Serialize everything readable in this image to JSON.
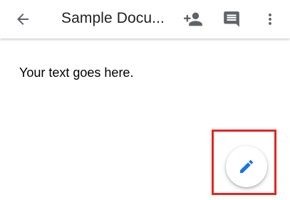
{
  "toolbar": {
    "back_icon": "arrow-back-icon",
    "title": "Sample Docu...",
    "share_icon": "person-add-icon",
    "comment_icon": "comment-icon",
    "more_icon": "more-vert-icon",
    "icon_color": "#5f6368"
  },
  "document": {
    "body_text": "Your text goes here."
  },
  "fab": {
    "icon": "edit-pencil-icon",
    "icon_color": "#1a73e8"
  },
  "annotation": {
    "highlight_color": "#e8251c"
  }
}
